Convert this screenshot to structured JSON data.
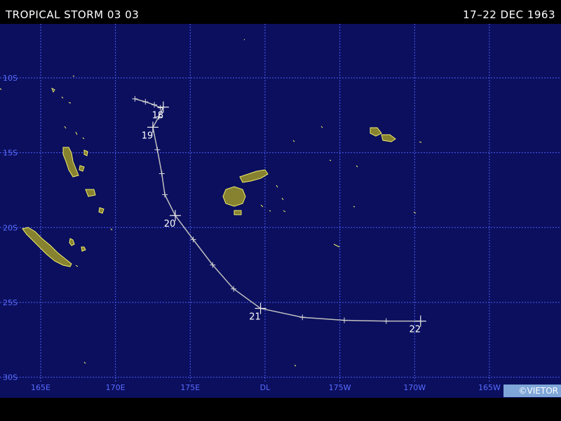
{
  "header": {
    "title": "TROPICAL STORM 03 03",
    "dates": "17–22 DEC 1963"
  },
  "credit": "©VIETOR",
  "colors": {
    "ocean": "#0b0f5e",
    "grid": "#4d5cf5",
    "land_fill": "#87822f",
    "land_outline": "#f2ef6a",
    "track": "#bfbfbf",
    "label": "#ffffff",
    "axis_label": "#5a6cff"
  },
  "map": {
    "lon_labels": [
      "165E",
      "170E",
      "175E",
      "DL",
      "175W",
      "170W",
      "165W"
    ],
    "lat_labels": [
      "10S",
      "15S",
      "20S",
      "25S",
      "30S"
    ],
    "track": {
      "points": [
        {
          "lon": 171.3,
          "lat": -11.4
        },
        {
          "lon": 172.0,
          "lat": -11.6
        },
        {
          "lon": 172.6,
          "lat": -11.8
        },
        {
          "lon": 173.0,
          "lat": -12.0
        },
        {
          "lon": 173.2,
          "lat": -11.95
        },
        {
          "lon": 172.9,
          "lat": -12.6
        },
        {
          "lon": 172.5,
          "lat": -13.3
        },
        {
          "lon": 172.8,
          "lat": -14.8
        },
        {
          "lon": 173.1,
          "lat": -16.4
        },
        {
          "lon": 173.3,
          "lat": -17.8
        },
        {
          "lon": 174.0,
          "lat": -19.2
        },
        {
          "lon": 175.2,
          "lat": -20.8
        },
        {
          "lon": 176.5,
          "lat": -22.5
        },
        {
          "lon": 177.9,
          "lat": -24.1
        },
        {
          "lon": 179.7,
          "lat": -25.4
        },
        {
          "lon": -177.5,
          "lat": -26.0
        },
        {
          "lon": -174.7,
          "lat": -26.2
        },
        {
          "lon": -171.9,
          "lat": -26.25
        },
        {
          "lon": -169.6,
          "lat": -26.25
        }
      ],
      "day_labels": [
        {
          "text": "18",
          "lon": 173.2,
          "lat": -11.95
        },
        {
          "text": "19",
          "lon": 172.5,
          "lat": -13.3
        },
        {
          "text": "20",
          "lon": 174.0,
          "lat": -19.2
        },
        {
          "text": "21",
          "lon": 179.7,
          "lat": -25.4
        },
        {
          "text": "22",
          "lon": -169.6,
          "lat": -26.25
        }
      ]
    }
  }
}
